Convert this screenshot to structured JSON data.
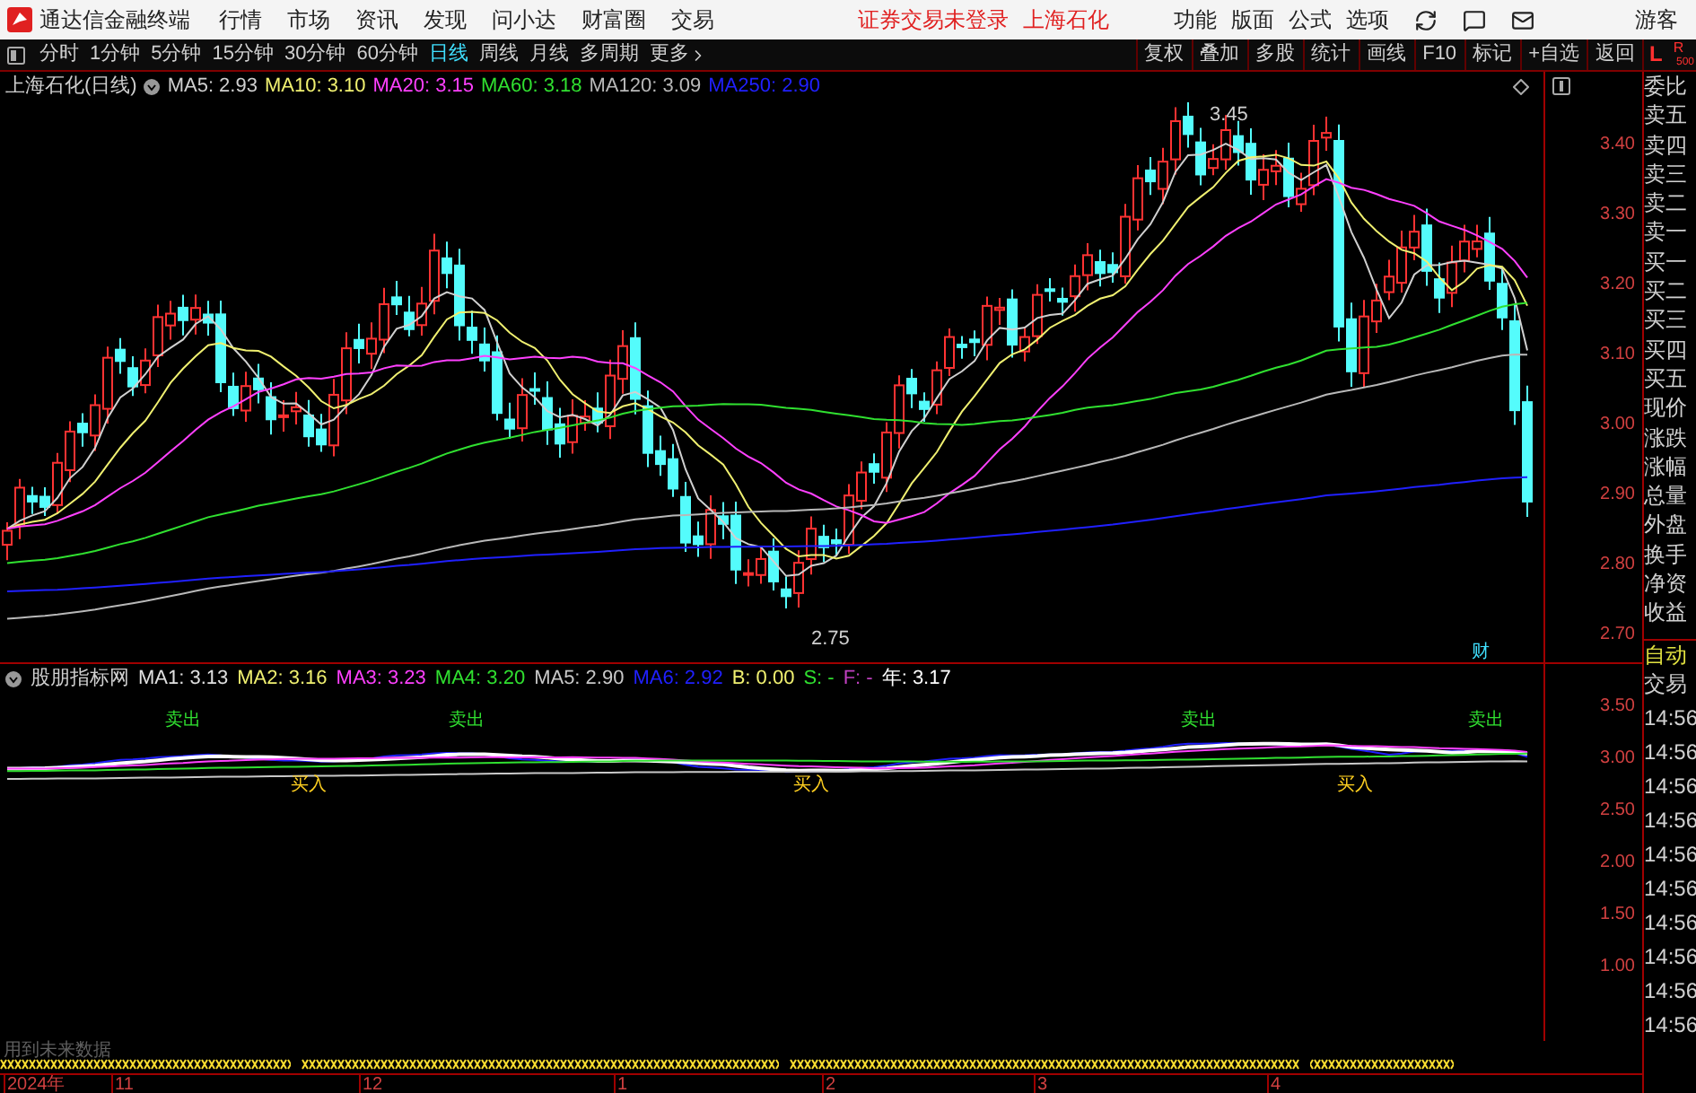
{
  "menu_bar": {
    "app_title": "通达信金融终端",
    "items": [
      "行情",
      "市场",
      "资讯",
      "发现",
      "问小达",
      "财富圈",
      "交易"
    ],
    "notice": "证券交易未登录",
    "stock": "上海石化",
    "right_items": [
      "功能",
      "版面",
      "公式",
      "选项"
    ],
    "user": "游客"
  },
  "toolbar": {
    "periods": [
      {
        "label": "分时",
        "selected": false
      },
      {
        "label": "1分钟",
        "selected": false
      },
      {
        "label": "5分钟",
        "selected": false
      },
      {
        "label": "15分钟",
        "selected": false
      },
      {
        "label": "30分钟",
        "selected": false
      },
      {
        "label": "60分钟",
        "selected": false
      },
      {
        "label": "日线",
        "selected": true
      },
      {
        "label": "周线",
        "selected": false
      },
      {
        "label": "月线",
        "selected": false
      },
      {
        "label": "多周期",
        "selected": false
      },
      {
        "label": "更多",
        "selected": false
      }
    ],
    "right_buttons": [
      "复权",
      "叠加",
      "多股",
      "统计",
      "画线",
      "F10",
      "标记",
      "+自选",
      "返回"
    ],
    "badge_left": "L",
    "badge_right": "R",
    "badge_number": "500"
  },
  "main_chart": {
    "title": "上海石化(日线)",
    "indicators": [
      {
        "label": "MA5: 2.93",
        "color": "#d0d0d0"
      },
      {
        "label": "MA10: 3.10",
        "color": "#f0f070"
      },
      {
        "label": "MA20: 3.15",
        "color": "#ff40ff"
      },
      {
        "label": "MA60: 3.18",
        "color": "#30e030"
      },
      {
        "label": "MA120: 3.09",
        "color": "#b8b8b8"
      },
      {
        "label": "MA250: 2.90",
        "color": "#2020ff"
      }
    ],
    "high_label": "3.45",
    "low_label": "2.75",
    "marker": "财",
    "y_axis": [
      "3.40",
      "3.30",
      "3.20",
      "3.10",
      "3.00",
      "2.90",
      "2.80",
      "2.70"
    ]
  },
  "indicator_panel": {
    "title": "股朋指标网",
    "values": [
      {
        "label": "MA1: 3.13",
        "color": "#e0e0e0"
      },
      {
        "label": "MA2: 3.16",
        "color": "#f0f070"
      },
      {
        "label": "MA3: 3.23",
        "color": "#ff40ff"
      },
      {
        "label": "MA4: 3.20",
        "color": "#30e030"
      },
      {
        "label": "MA5: 2.90",
        "color": "#c8c8c8"
      },
      {
        "label": "MA6: 2.92",
        "color": "#2020ff"
      },
      {
        "label": "B: 0.00",
        "color": "#f0f070"
      },
      {
        "label": "S: -",
        "color": "#30e030"
      },
      {
        "label": "F: -",
        "color": "#c040c0"
      },
      {
        "label": "年: 3.17",
        "color": "#ffffff"
      }
    ],
    "signals": [
      {
        "text": "卖出",
        "kind": "sell"
      },
      {
        "text": "买入",
        "kind": "buy"
      },
      {
        "text": "卖出",
        "kind": "sell"
      },
      {
        "text": "买入",
        "kind": "buy"
      },
      {
        "text": "卖出",
        "kind": "sell"
      },
      {
        "text": "买入",
        "kind": "buy"
      },
      {
        "text": "卖出",
        "kind": "sell"
      }
    ],
    "y_axis": [
      "3.50",
      "3.00",
      "2.50",
      "2.00",
      "1.50",
      "1.00"
    ]
  },
  "footer": {
    "note": "用到未来数据",
    "timeline": [
      "2024年",
      "11",
      "12",
      "1",
      "2",
      "3",
      "4"
    ]
  },
  "side_panel": {
    "items": [
      "委比",
      "卖五",
      "卖四",
      "卖三",
      "卖二",
      "卖一",
      "买一",
      "买二",
      "买三",
      "买四",
      "买五",
      "现价",
      "涨跌",
      "涨幅",
      "总量",
      "外盘",
      "换手",
      "净资",
      "收益"
    ],
    "auto": "自动",
    "trade": "交易",
    "times": [
      "14:56",
      "14:56",
      "14:56",
      "14:56",
      "14:56",
      "14:56",
      "14:56",
      "14:56",
      "14:56",
      "14:56"
    ]
  }
}
